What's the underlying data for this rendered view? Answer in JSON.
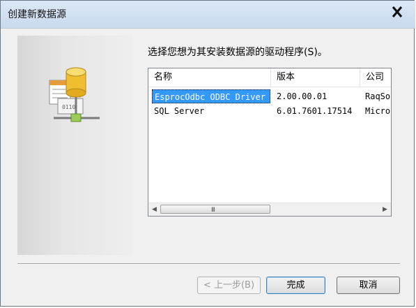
{
  "window": {
    "title": "创建新数据源"
  },
  "instruction": "选择您想为其安装数据源的驱动程序(S)。",
  "table": {
    "columns": [
      "名称",
      "版本",
      "公司"
    ],
    "rows": [
      {
        "name": "EsprocOdbc ODBC Driver",
        "version": "2.00.00.01",
        "company": "RaqSo"
      },
      {
        "name": "SQL Server",
        "version": "6.01.7601.17514",
        "company": "Micro"
      }
    ]
  },
  "scrollbar": {
    "left_arrow": "◀",
    "right_arrow": "▶",
    "grip": "III"
  },
  "buttons": {
    "back": "< 上一步(B)",
    "finish": "完成",
    "cancel": "取消"
  },
  "colors": {
    "selection": "#3399ff",
    "titlebar": "#c9daee"
  },
  "icons": {
    "close": "close-icon",
    "wizard": "database-network-icon"
  }
}
